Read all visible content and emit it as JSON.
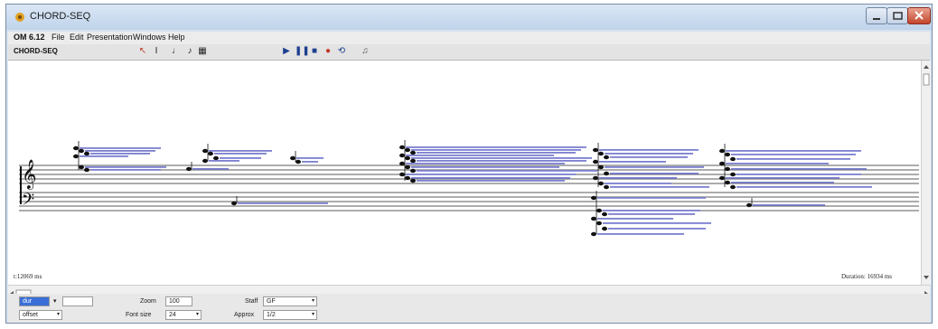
{
  "window": {
    "title": "CHORD-SEQ"
  },
  "menu": {
    "items": [
      "OM 6.12",
      "File",
      "Edit",
      "Presentation",
      "Windows",
      "Help"
    ]
  },
  "toolbar": {
    "title": "CHORD-SEQ"
  },
  "score": {
    "time_label": "t:12069 ms",
    "duration_label": "Duration: 16934 ms"
  },
  "controls": {
    "select1_value": "dur",
    "select2_value": "offset",
    "zoom_label": "Zoom",
    "zoom_value": "100",
    "font_size_label": "Font size",
    "font_size_value": "24",
    "staff_label": "Staff",
    "staff_value": "GF",
    "approx_label": "Approx",
    "approx_value": "1/2"
  },
  "colors": {
    "duration_line": "#7b7fcf",
    "selection": "#3a6fd8"
  }
}
